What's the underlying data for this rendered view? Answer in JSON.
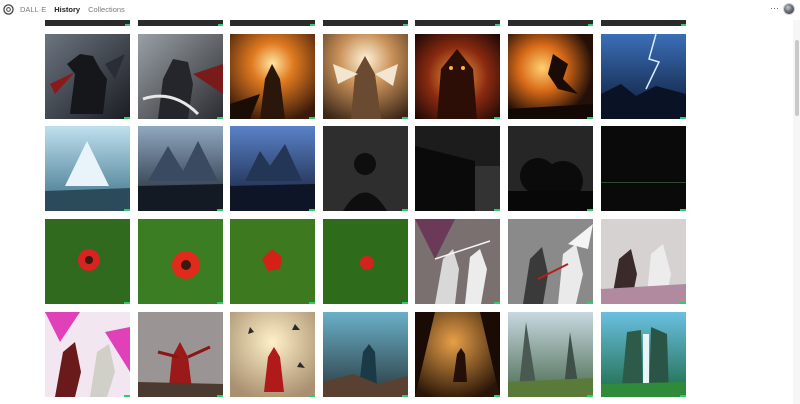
{
  "topbar": {
    "logo_icon": "openai-logo-icon",
    "app_name": "DALL·E",
    "tabs": [
      {
        "label": "History",
        "active": true
      },
      {
        "label": "Collections",
        "active": false
      }
    ],
    "more_label": "···",
    "more_icon": "more-horizontal-icon",
    "avatar_icon": "user-avatar"
  },
  "grid": {
    "rows": [
      {
        "theme": "dark armored warriors and fiery battle scenes"
      },
      {
        "theme": "armies before mountains and dark silhouettes"
      },
      {
        "theme": "red flower on grass and white knights fighting"
      },
      {
        "theme": "red demons and fantasy landscapes"
      }
    ]
  },
  "colors": {
    "accent_green": "#2ecc71",
    "background": "#ffffff"
  }
}
